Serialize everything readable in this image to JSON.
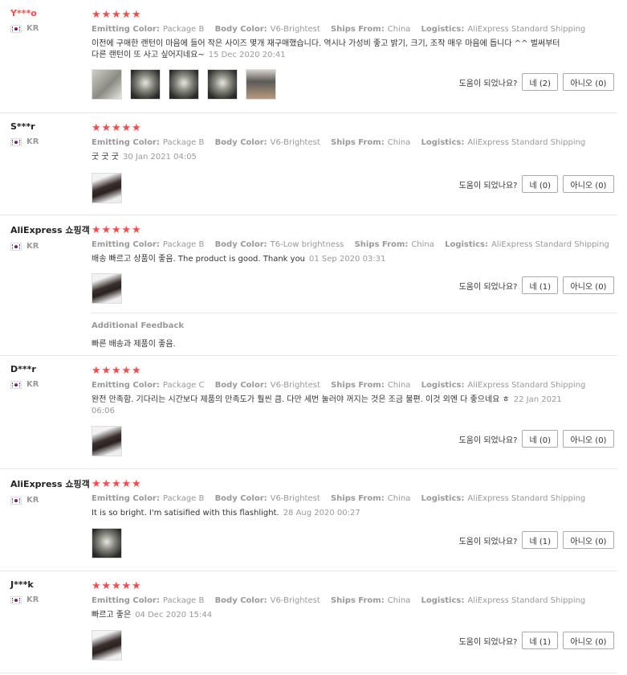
{
  "labels": {
    "emitting": "Emitting Color:",
    "body": "Body Color:",
    "ships": "Ships From:",
    "logistics": "Logistics:",
    "helpful": "도움이 되었나요?",
    "additional": "Additional Feedback"
  },
  "reviews": [
    {
      "name": "Y***o",
      "country": "KR",
      "stars": 5,
      "emitting": "Package B",
      "body": "V6-Brightest",
      "ships": "China",
      "logistics": "AliExpress Standard Shipping",
      "text": "이전에 구매한 랜턴이 마음에 들어 작은 사이즈 몇개 재구매했습니다. 역시나 가성비 좋고 밝기, 크기, 조작 매우 마음에 듭니다 ^^ 벌써부터 다른 랜턴이 또 사고 싶어지네요~",
      "date": "15 Dec 2020 20:41",
      "yes": "네 (2)",
      "no": "아니오 (0)",
      "photos": [
        "flashlight-pair-photo",
        "light-beam-photo",
        "light-beam-photo",
        "light-beam-photo",
        "flashlight-in-hand-photo"
      ],
      "additional": null
    },
    {
      "name": "S***r",
      "country": "KR",
      "stars": 5,
      "emitting": "Package B",
      "body": "V6-Brightest",
      "ships": "China",
      "logistics": "AliExpress Standard Shipping",
      "text": "굿 굿 굿",
      "date": "30 Jan 2021 04:05",
      "yes": "네 (0)",
      "no": "아니오 (0)",
      "photos": [
        "flashlight-photo"
      ],
      "additional": null
    },
    {
      "name": "AliExpress 쇼핑객",
      "country": "KR",
      "stars": 5,
      "emitting": "Package B",
      "body": "T6-Low brightness",
      "ships": "China",
      "logistics": "AliExpress Standard Shipping",
      "text": "배송 빠르고 상품이 좋음. The product is good. Thank you",
      "date": "01 Sep 2020 03:31",
      "yes": "네 (1)",
      "no": "아니오 (0)",
      "photos": [
        "flashlight-photo"
      ],
      "additional": "빠른 배송과 제품이 좋음."
    },
    {
      "name": "D***r",
      "country": "KR",
      "stars": 5,
      "emitting": "Package C",
      "body": "V6-Brightest",
      "ships": "China",
      "logistics": "AliExpress Standard Shipping",
      "text": "완전 만족함. 기다리는 시간보다 제품의 만족도가 훨씬 큼. 다만 세번 눌러야 꺼지는 것은 조금 불편. 이것 외엔 다 좋으네요 ㅎ",
      "date": "22 Jan 2021 06:06",
      "yes": "네 (0)",
      "no": "아니오 (0)",
      "photos": [
        "flashlight-photo"
      ],
      "additional": null
    },
    {
      "name": "AliExpress 쇼핑객",
      "country": "KR",
      "stars": 5,
      "emitting": "Package B",
      "body": "V6-Brightest",
      "ships": "China",
      "logistics": "AliExpress Standard Shipping",
      "text": "It is so bright. I'm satisified with this flashlight.",
      "date": "28 Aug 2020 00:27",
      "yes": "네 (1)",
      "no": "아니오 (0)",
      "photos": [
        "light-beam-photo"
      ],
      "additional": null
    },
    {
      "name": "J***k",
      "country": "KR",
      "stars": 5,
      "emitting": "Package B",
      "body": "V6-Brightest",
      "ships": "China",
      "logistics": "AliExpress Standard Shipping",
      "text": "빠르고 좋은",
      "date": "04 Dec 2020 15:44",
      "yes": "네 (1)",
      "no": "아니오 (0)",
      "photos": [
        "flashlight-photo"
      ],
      "additional": null
    }
  ]
}
